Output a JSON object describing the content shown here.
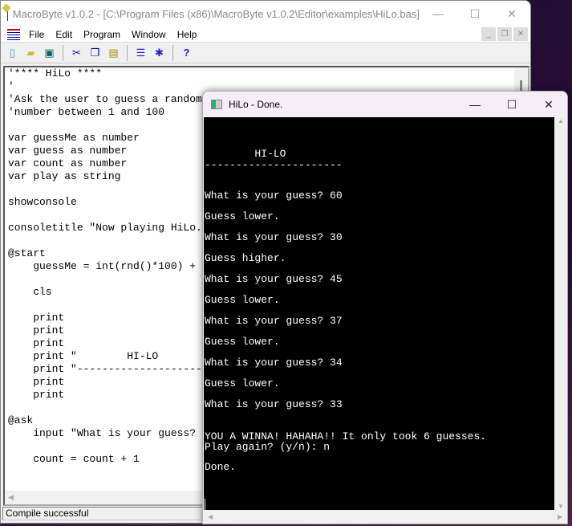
{
  "main_window": {
    "title": "MacroByte v1.0.2 - [C:\\Program Files (x86)\\MacroByte v1.0.2\\Editor\\examples\\HiLo.bas]",
    "menu": [
      "File",
      "Edit",
      "Program",
      "Window",
      "Help"
    ],
    "toolbar": [
      "new",
      "open",
      "save",
      "cut",
      "copy",
      "paste",
      "run",
      "debug",
      "help"
    ],
    "code_lines": [
      "'**** HiLo ****",
      "'",
      "'Ask the user to guess a random",
      "'number between 1 and 100",
      "",
      "var guessMe as number",
      "var guess as number",
      "var count as number",
      "var play as string",
      "",
      "showconsole",
      "",
      "consoletitle \"Now playing HiLo.",
      "",
      "@start",
      "    guessMe = int(rnd()*100) +",
      "",
      "    cls",
      "",
      "    print",
      "    print",
      "    print",
      "    print \"        HI-LO",
      "    print \"--------------------------",
      "    print",
      "    print",
      "",
      "@ask",
      "    input \"What is your guess?",
      "",
      "    count = count + 1"
    ],
    "status": "Compile successful"
  },
  "console_window": {
    "title": "HiLo - Done.",
    "lines": [
      {
        "text": "        HI-LO"
      },
      {
        "text": "----------------------"
      },
      {
        "text": "What is your guess? 60"
      },
      {
        "text": "Guess lower."
      },
      {
        "text": "What is your guess? 30"
      },
      {
        "text": "Guess higher."
      },
      {
        "text": "What is your guess? 45"
      },
      {
        "text": "Guess lower."
      },
      {
        "text": "What is your guess? 37"
      },
      {
        "text": "Guess lower."
      },
      {
        "text": "What is your guess? 34"
      },
      {
        "text": "Guess lower."
      },
      {
        "text": "What is your guess? 33"
      },
      {
        "text": "YOU A WINNA! HAHAHA!! It only took 6 guesses."
      },
      {
        "text": "Play again? (y/n): n"
      },
      {
        "text": "Done."
      }
    ]
  }
}
